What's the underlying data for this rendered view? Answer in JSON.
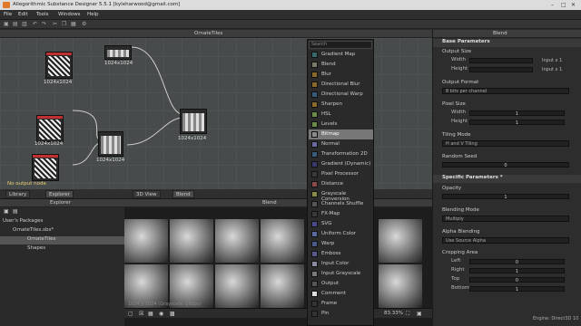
{
  "app": {
    "title": "Allegorithmic Substance Designer 5.5.1 [kyleharwood@gmail.com]"
  },
  "menu": [
    "File",
    "Edit",
    "Tools",
    "Windows",
    "Help"
  ],
  "graph": {
    "title": "OrnateTiles",
    "node_labels": [
      "1024x1024",
      "1024x1024",
      "1024x1024",
      "1024x1024",
      "1024x1024"
    ],
    "warning": "No output node"
  },
  "lower_tabs": {
    "library": "Library",
    "explorer": "Explorer",
    "view3d": "3D View",
    "blend": "Blend"
  },
  "explorer": {
    "header": "Explorer",
    "packages_label": "User's Packages",
    "package": "OrnateTiles.sbs*",
    "graph": "OrnateTiles",
    "shapes": "Shapes"
  },
  "viewer": {
    "title": "Blend",
    "info": "1024 x 1024 (Grayscale, 16bpc)",
    "zoom": "83.33%"
  },
  "right": {
    "title": "Blend",
    "base_params": "Base Parameters",
    "output_size": "Output Size",
    "width": "Width",
    "height": "Height",
    "width_suffix": "Input x 1",
    "height_suffix": "Input x 1",
    "output_format": "Output Format",
    "output_format_val": "8 bits per channel",
    "pixel_size": "Pixel Size",
    "px_width": "Width",
    "px_height": "Height",
    "px_w_val": "1",
    "px_h_val": "1",
    "tiling_mode": "Tiling Mode",
    "tiling_val": "H and V Tiling",
    "random_seed": "Random Seed",
    "seed_val": "0",
    "specific_params": "Specific Parameters *",
    "opacity": "Opacity",
    "opacity_val": "1",
    "blending_mode": "Blending Mode",
    "blending_val": "Multiply",
    "alpha_blending": "Alpha Blending",
    "alpha_val": "Use Source Alpha",
    "cropping_area": "Cropping Area",
    "left": "Left",
    "right_lbl": "Right",
    "top": "Top",
    "bottom": "Bottom",
    "left_val": "0",
    "right_val": "1",
    "top_val": "0",
    "bottom_val": "1"
  },
  "context_menu": {
    "search_placeholder": "Search",
    "items": [
      {
        "label": "Gradient Map",
        "color": "#3a6a6a"
      },
      {
        "label": "Blend",
        "color": "#7a7a6a"
      },
      {
        "label": "Blur",
        "color": "#8a6a2a"
      },
      {
        "label": "Directional Blur",
        "color": "#8a6a2a"
      },
      {
        "label": "Directional Warp",
        "color": "#3a5a7a"
      },
      {
        "label": "Sharpen",
        "color": "#8a6a2a"
      },
      {
        "label": "HSL",
        "color": "#6a8a4a"
      },
      {
        "label": "Levels",
        "color": "#6a8a4a"
      },
      {
        "label": "Bitmap",
        "color": "#8a8a8a"
      },
      {
        "label": "Normal",
        "color": "#6a6aa0"
      },
      {
        "label": "Transformation 2D",
        "color": "#3a5a7a"
      },
      {
        "label": "Gradient (Dynamic)",
        "color": "#3a3a6a"
      },
      {
        "label": "Pixel Processor",
        "color": "#3a3a3a"
      },
      {
        "label": "Distance",
        "color": "#8a4a4a"
      },
      {
        "label": "Grayscale Conversion",
        "color": "#8a8a4a"
      },
      {
        "label": "Channels Shuffle",
        "color": "#555555"
      },
      {
        "label": "FX-Map",
        "color": "#3a3a3a"
      },
      {
        "label": "SVG",
        "color": "#4a4a8a"
      },
      {
        "label": "Uniform Color",
        "color": "#5a6aa0"
      },
      {
        "label": "Warp",
        "color": "#4a5a8a"
      },
      {
        "label": "Emboss",
        "color": "#5a5a8a"
      },
      {
        "label": "Input Color",
        "color": "#8a8aa0"
      },
      {
        "label": "Input Grayscale",
        "color": "#7a7a7a"
      },
      {
        "label": "Output",
        "color": "#555555"
      },
      {
        "label": "Comment",
        "color": "#dddddd"
      },
      {
        "label": "Frame",
        "color": "#333333"
      },
      {
        "label": "Pin",
        "color": "#333333"
      }
    ],
    "highlight_index": 8
  },
  "status": {
    "engine": "Engine: Direct3D 10"
  }
}
